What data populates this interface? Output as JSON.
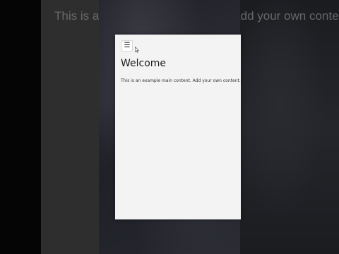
{
  "background": {
    "ghost_text": "This is an example main content. Add your own content"
  },
  "page": {
    "menu_icon": "☰",
    "title": "Welcome",
    "body": "This is an example main content. Add your own content."
  },
  "colors": {
    "panel_bg": "#f3f3f3",
    "backdrop": "#2b2c35"
  }
}
